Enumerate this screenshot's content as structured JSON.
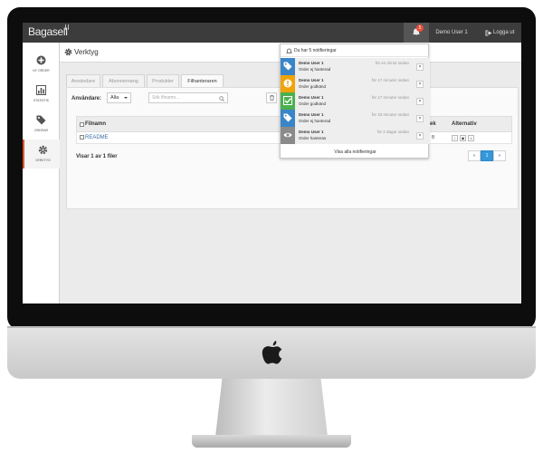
{
  "topbar": {
    "logo": "Bagasell",
    "notification_count": "5",
    "user": "Demo User 1",
    "logout": "Logga ut"
  },
  "sidebar": {
    "items": [
      {
        "label": "Ny order",
        "icon": "plus-circle-icon"
      },
      {
        "label": "Statistik",
        "icon": "bar-chart-icon"
      },
      {
        "label": "Ordrar",
        "icon": "tags-icon"
      },
      {
        "label": "Verktyg",
        "icon": "gear-icon",
        "active": true
      }
    ]
  },
  "page": {
    "title": "Verktyg",
    "tabs": [
      {
        "label": "Användare"
      },
      {
        "label": "Abonnemang"
      },
      {
        "label": "Produkter"
      },
      {
        "label": "Filhanteraren",
        "active": true
      }
    ]
  },
  "filters": {
    "users_label": "Användare:",
    "users_value": "Alla",
    "search_placeholder": "Sök filnamn..."
  },
  "table": {
    "headers": {
      "name": "Filnamn",
      "k": "ek",
      "options": "Alternativ"
    },
    "rows": [
      {
        "name": "README",
        "k": "B"
      }
    ]
  },
  "footer": {
    "info": "Visar 1 av 1 filer",
    "pager": [
      "«",
      "1",
      "»"
    ]
  },
  "notifications": {
    "header": "Du har 5 notifieringar",
    "footer": "Visa alla notifieringar",
    "items": [
      {
        "user": "Demo User 1",
        "message": "Order ej hanterad",
        "time": "för en minut sedan",
        "color": "#3a85c8",
        "icon": "tag-icon"
      },
      {
        "user": "Demo User 1",
        "message": "Order godkänd",
        "time": "för 17 minuter sedan",
        "color": "#f0a30a",
        "icon": "info-icon"
      },
      {
        "user": "Demo User 1",
        "message": "Order godkänd",
        "time": "för 17 minuter sedan",
        "color": "#4caf50",
        "icon": "check-icon"
      },
      {
        "user": "Demo User 1",
        "message": "Order ej hanterad",
        "time": "för 33 minuter sedan",
        "color": "#3a85c8",
        "icon": "tag-icon"
      },
      {
        "user": "Demo User 1",
        "message": "Order hanteras",
        "time": "för 2 dagar sedan",
        "color": "#8a8a8a",
        "icon": "eye-icon"
      }
    ]
  },
  "colors": {
    "topbar": "#3c3c3c",
    "accent": "#e2542a",
    "primary": "#3498db"
  }
}
